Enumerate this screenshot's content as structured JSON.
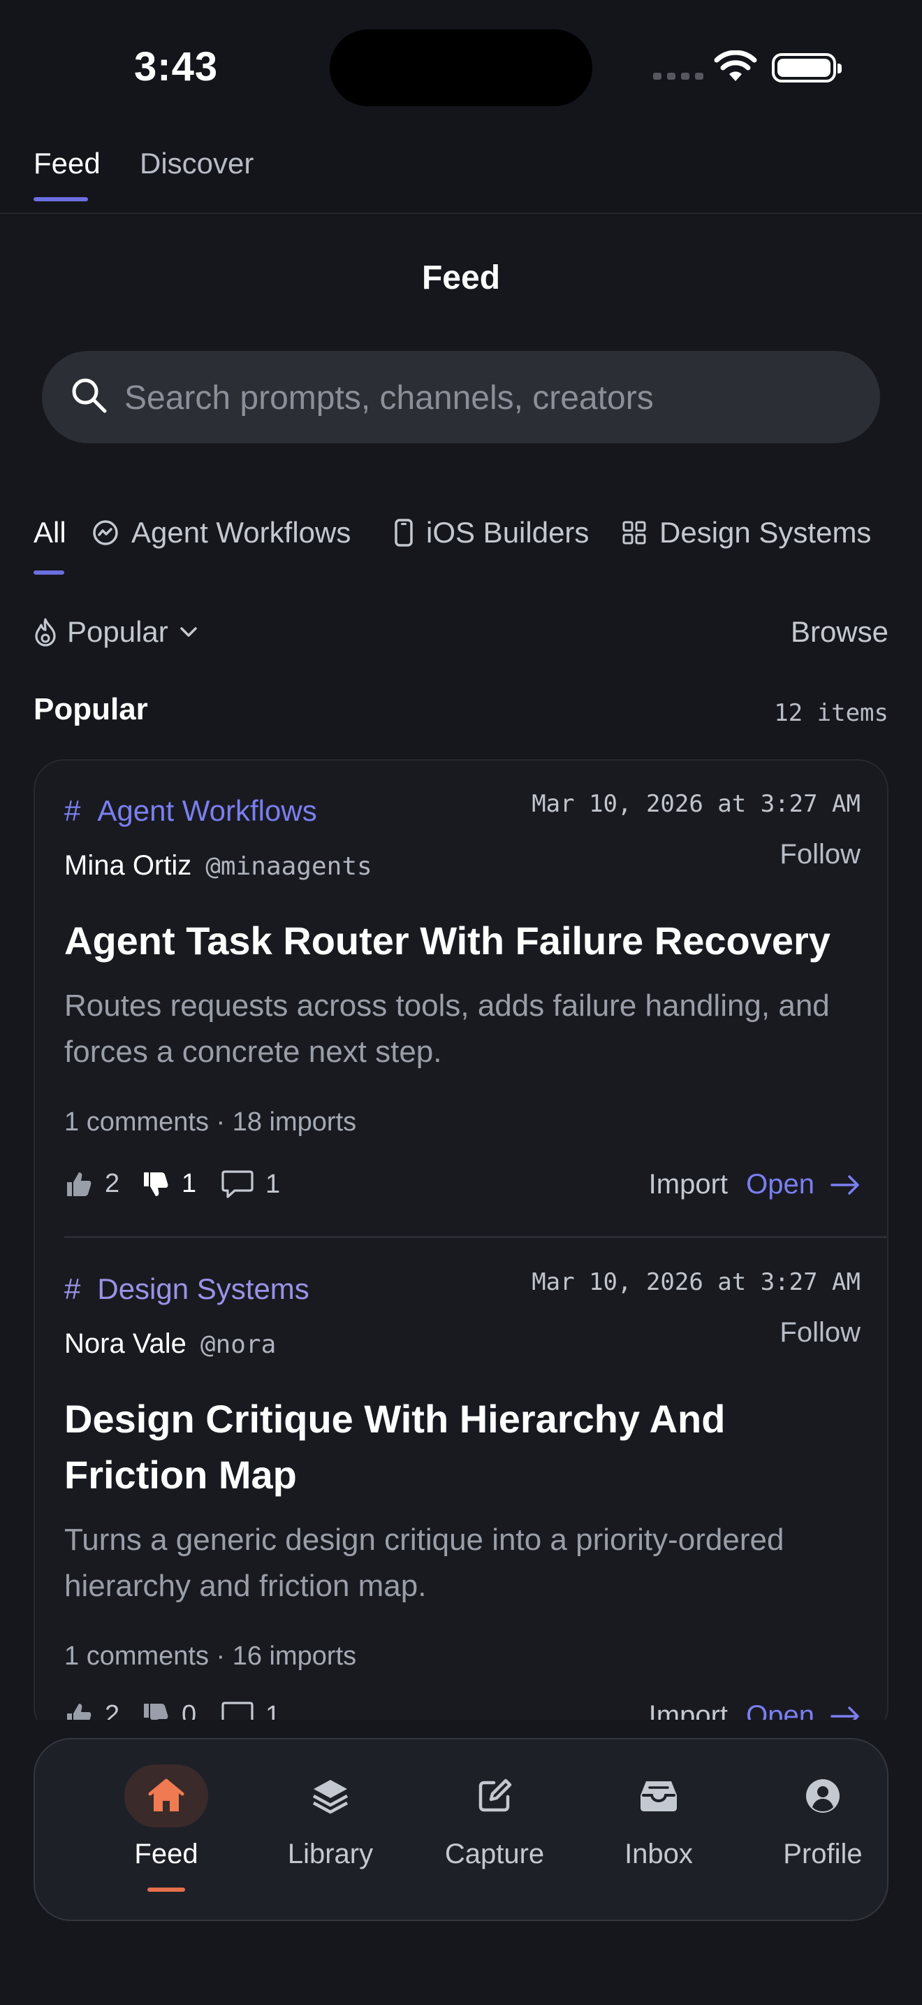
{
  "status_bar": {
    "time": "3:43"
  },
  "top_tabs": [
    {
      "label": "Feed",
      "active": true
    },
    {
      "label": "Discover",
      "active": false
    }
  ],
  "page_title": "Feed",
  "search": {
    "placeholder": "Search prompts, channels, creators"
  },
  "chips": [
    {
      "label": "All",
      "icon": "none",
      "active": true
    },
    {
      "label": "Agent Workflows",
      "icon": "agent-icon"
    },
    {
      "label": "iOS Builders",
      "icon": "phone-icon"
    },
    {
      "label": "Design Systems",
      "icon": "grid-icon"
    }
  ],
  "sort": {
    "label": "Popular",
    "icon": "flame-icon",
    "browse": "Browse"
  },
  "section": {
    "title": "Popular",
    "count": "12 items"
  },
  "posts": [
    {
      "channel": "Agent Workflows",
      "date": "Mar 10, 2026 at 3:27 AM",
      "author": "Mina Ortiz",
      "handle": "@minaagents",
      "follow": "Follow",
      "title": "Agent Task Router With Failure Recovery",
      "description": "Routes requests across tools, adds failure handling, and forces a concrete next step.",
      "meta": "1 comments · 18 imports",
      "likes": "2",
      "dislikes": "1",
      "comments": "1",
      "import": "Import",
      "open": "Open"
    },
    {
      "channel": "Design Systems",
      "date": "Mar 10, 2026 at 3:27 AM",
      "author": "Nora Vale",
      "handle": "@nora",
      "follow": "Follow",
      "title": "Design Critique With Hierarchy And Friction Map",
      "description": "Turns a generic design critique into a priority-ordered hierarchy and friction map.",
      "meta": "1 comments · 16 imports",
      "likes": "2",
      "dislikes": "0",
      "comments": "1",
      "import": "Import",
      "open": "Open"
    }
  ],
  "tabbar": [
    {
      "label": "Feed",
      "icon": "home-icon",
      "active": true
    },
    {
      "label": "Library",
      "icon": "layers-icon"
    },
    {
      "label": "Capture",
      "icon": "edit-icon"
    },
    {
      "label": "Inbox",
      "icon": "inbox-icon"
    },
    {
      "label": "Profile",
      "icon": "profile-icon"
    }
  ],
  "colors": {
    "accent": "#6b6fe0",
    "active_tab": "#e5704a",
    "background": "#15171c"
  }
}
